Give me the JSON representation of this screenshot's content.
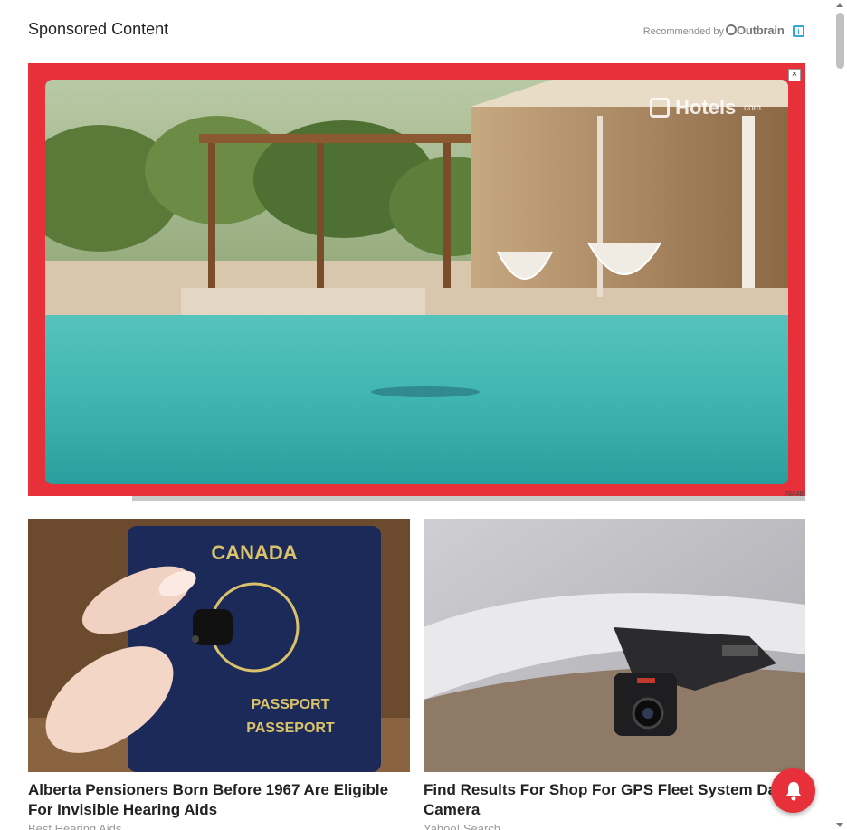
{
  "header": {
    "title": "Sponsored Content",
    "recommended_by": "Recommended by",
    "provider": "Outbrain"
  },
  "video_ad": {
    "brand": "Hotels",
    "brand_suffix": ".com",
    "ad_id": "78A4B",
    "close_label": "×",
    "frame_color": "#e8303b"
  },
  "cards": [
    {
      "title": "Alberta Pensioners Born Before 1967 Are Eligible For Invisible Hearing Aids",
      "title_line1": "Alberta Pensioners Born Before 1967 Are Eligible",
      "title_line2": "For Invisible Hearing Aids",
      "source": "Best Hearing Aids",
      "passport_text": [
        "CANADA",
        "PASSPORT",
        "PASSEPORT"
      ]
    },
    {
      "title_line1": "Find Results For Shop For GPS Fleet System Dash",
      "title_line2": "Camera",
      "source": "Yahoo! Search"
    }
  ],
  "notification_bell": {
    "color": "#e8303b",
    "icon": "bell-icon"
  }
}
